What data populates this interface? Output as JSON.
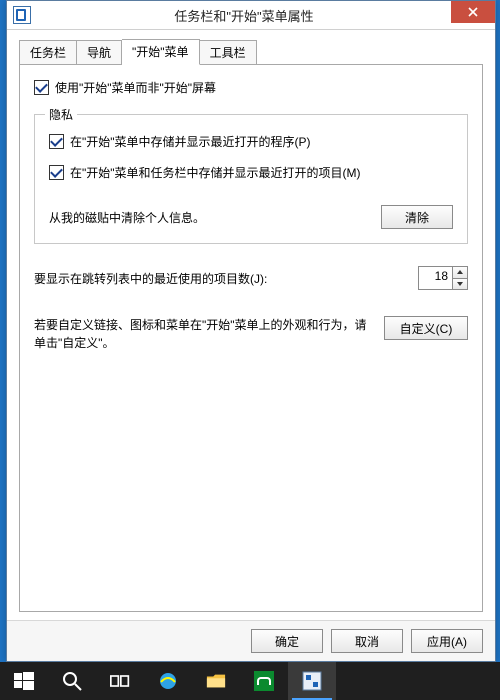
{
  "window": {
    "title": "任务栏和\"开始\"菜单属性"
  },
  "tabs": {
    "t0": "任务栏",
    "t1": "导航",
    "t2": "\"开始\"菜单",
    "t3": "工具栏"
  },
  "main": {
    "use_start_menu_label": "使用\"开始\"菜单而非\"开始\"屏幕"
  },
  "privacy": {
    "legend": "隐私",
    "store_programs_label": "在\"开始\"菜单中存储并显示最近打开的程序(P)",
    "store_items_label": "在\"开始\"菜单和任务栏中存储并显示最近打开的项目(M)",
    "clear_desc": "从我的磁贴中清除个人信息。",
    "clear_btn": "清除"
  },
  "jumplist": {
    "label": "要显示在跳转列表中的最近使用的项目数(J):",
    "value": "18"
  },
  "customize": {
    "desc": "若要自定义链接、图标和菜单在\"开始\"菜单上的外观和行为，请单击\"自定义\"。",
    "btn": "自定义(C)"
  },
  "buttons": {
    "ok": "确定",
    "cancel": "取消",
    "apply": "应用(A)"
  }
}
